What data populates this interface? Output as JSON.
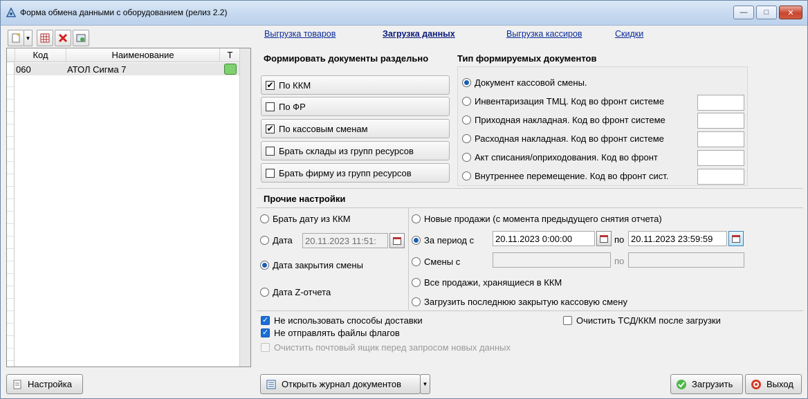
{
  "window": {
    "title": "Форма обмена данными с оборудованием (релиз 2.2)",
    "minimize": "—",
    "maximize": "□",
    "close": "✕"
  },
  "toolbar": {
    "icons": [
      "new-icon",
      "dropdown-icon",
      "table-icon",
      "delete-icon",
      "refresh-icon"
    ]
  },
  "grid": {
    "columns": [
      "Код",
      "Наименование",
      "Т"
    ],
    "rows": [
      {
        "code": "060",
        "name": "АТОЛ Сигма 7",
        "t": "green"
      }
    ]
  },
  "tabs": [
    {
      "label": "Выгрузка товаров",
      "active": false
    },
    {
      "label": "Загрузка данных",
      "active": true
    },
    {
      "label": "Выгрузка кассиров",
      "active": false
    },
    {
      "label": "Скидки",
      "active": false
    }
  ],
  "separate": {
    "title": "Формировать документы раздельно",
    "items": [
      {
        "label": "По ККМ",
        "checked": true
      },
      {
        "label": "По ФР",
        "checked": false
      },
      {
        "label": "По кассовым сменам",
        "checked": true
      },
      {
        "label": "Брать склады из групп ресурсов",
        "checked": false
      },
      {
        "label": "Брать фирму из групп ресурсов",
        "checked": false
      }
    ]
  },
  "doc_types": {
    "title": "Тип формируемых документов",
    "items": [
      {
        "label": "Документ кассовой смены.",
        "selected": true
      },
      {
        "label": "Инвентаризация ТМЦ. Код во фронт системе",
        "selected": false
      },
      {
        "label": "Приходная накладная. Код во фронт системе",
        "selected": false
      },
      {
        "label": "Расходная накладная. Код во фронт системе",
        "selected": false
      },
      {
        "label": "Акт списания/оприходования. Код во фронт",
        "selected": false
      },
      {
        "label": "Внутреннее перемещение. Код во фронт сист.",
        "selected": false
      }
    ]
  },
  "other": {
    "title": "Прочие настройки",
    "date_options": [
      {
        "label": "Брать дату из ККМ",
        "selected": false
      },
      {
        "label": "Дата",
        "selected": false
      },
      {
        "label": "Дата закрытия смены",
        "selected": true
      },
      {
        "label": "Дата Z-отчета",
        "selected": false
      }
    ],
    "date_value": "20.11.2023 11:51:",
    "period_options": [
      {
        "label": "Новые продажи (с момента предыдущего снятия отчета)",
        "selected": false
      },
      {
        "label": "За период с",
        "selected": true
      },
      {
        "label": "Смены с",
        "selected": false
      },
      {
        "label": "Все продажи, хранящиеся в ККМ",
        "selected": false
      },
      {
        "label": "Загрузить последнюю закрытую кассовую смену",
        "selected": false
      }
    ],
    "period_from": "20.11.2023 0:00:00",
    "period_to": "20.11.2023 23:59:59",
    "to_label": "по"
  },
  "checks": [
    {
      "label": "Не использовать способы доставки",
      "checked": true,
      "enabled": true
    },
    {
      "label": "Не отправлять файлы флагов",
      "checked": true,
      "enabled": true
    },
    {
      "label": "Очистить почтовый ящик перед запросом новых данных",
      "checked": false,
      "enabled": false
    },
    {
      "label": "Очистить ТСД/ККМ после загрузки",
      "checked": false,
      "enabled": true
    }
  ],
  "buttons": {
    "settings": "Настройка",
    "journal": "Открыть журнал документов",
    "load": "Загрузить",
    "exit": "Выход"
  }
}
